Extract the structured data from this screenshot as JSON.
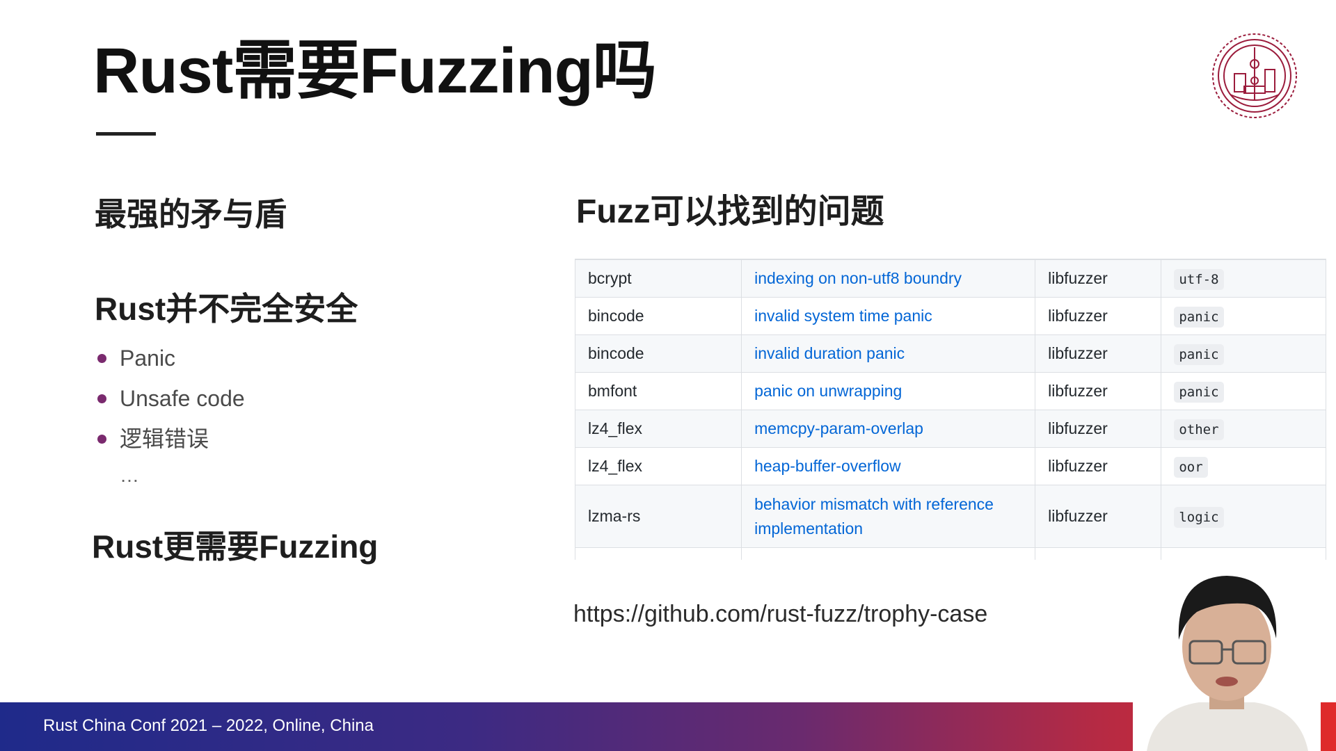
{
  "slide": {
    "title": "Rust需要Fuzzing吗"
  },
  "left": {
    "heading1": "最强的矛与盾",
    "heading2": "Rust并不完全安全",
    "bullets": [
      "Panic",
      "Unsafe code",
      "逻辑错误"
    ],
    "ellipsis": "…",
    "heading3": "Rust更需要Fuzzing"
  },
  "right": {
    "heading": "Fuzz可以找到的问题",
    "rows": [
      {
        "crate": "bcrypt",
        "issue": "indexing on non-utf8 boundry",
        "tool": "libfuzzer",
        "tag": "utf-8"
      },
      {
        "crate": "bincode",
        "issue": "invalid system time panic",
        "tool": "libfuzzer",
        "tag": "panic"
      },
      {
        "crate": "bincode",
        "issue": "invalid duration panic",
        "tool": "libfuzzer",
        "tag": "panic"
      },
      {
        "crate": "bmfont",
        "issue": "panic on unwrapping",
        "tool": "libfuzzer",
        "tag": "panic"
      },
      {
        "crate": "lz4_flex",
        "issue": "memcpy-param-overlap",
        "tool": "libfuzzer",
        "tag": "other"
      },
      {
        "crate": "lz4_flex",
        "issue": "heap-buffer-overflow",
        "tool": "libfuzzer",
        "tag": "oor"
      },
      {
        "crate": "lzma-rs",
        "issue_line1": "behavior mismatch with reference",
        "issue_line2": "implementation",
        "tool": "libfuzzer",
        "tag": "logic"
      }
    ],
    "url": "https://github.com/rust-fuzz/trophy-case"
  },
  "footer": {
    "text": "Rust China Conf 2021 – 2022, Online, China"
  },
  "colors": {
    "link": "#0366d6",
    "bullet": "#7a2a6e",
    "logo": "#9b1c3c"
  },
  "icons": {
    "logo": "university-seal-logo",
    "speaker": "speaker-video-overlay"
  }
}
